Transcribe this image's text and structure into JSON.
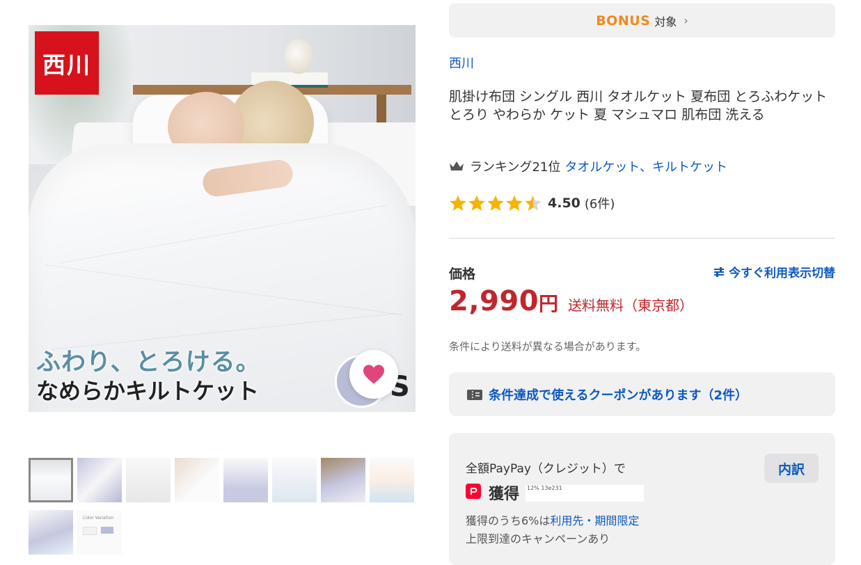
{
  "product_image": {
    "brand_badge": "西川",
    "catch_line1": "ふわり、とろける。",
    "catch_line2": "なめらかキルトケット",
    "swatch_letter": "S"
  },
  "thumbnails": [
    {
      "name": "thumb-1",
      "selected": true
    },
    {
      "name": "thumb-2"
    },
    {
      "name": "thumb-3"
    },
    {
      "name": "thumb-4"
    },
    {
      "name": "thumb-5"
    },
    {
      "name": "thumb-6"
    },
    {
      "name": "thumb-7"
    },
    {
      "name": "thumb-8"
    },
    {
      "name": "thumb-9"
    },
    {
      "name": "thumb-10",
      "label": "Color Variation"
    }
  ],
  "bonus": {
    "logo": "BONUS",
    "label": "対象"
  },
  "store": {
    "name": "西川"
  },
  "product": {
    "title": "肌掛け布団 シングル 西川 タオルケット 夏布団 とろふわケット とろり やわらか ケット 夏 マシュマロ 肌布団 洗える",
    "ranking_label": "ランキング21位",
    "ranking_categories": "タオルケット、キルトケット",
    "rating_score": "4.50",
    "rating_count": "(6件)",
    "rating_value": 4.5
  },
  "price": {
    "label": "価格",
    "switch_link": "今すぐ利用表示切替",
    "amount": "2,990",
    "currency": "円",
    "shipping": "送料無料（東京都）",
    "condition_note": "条件により送料が異なる場合があります。"
  },
  "coupon": {
    "text": "条件達成で使えるクーポンがあります（2件）"
  },
  "paypay": {
    "line1": "全額PayPay（クレジット）で",
    "breakdown_button": "内訳",
    "earn_label": "獲得",
    "tiny_text": "12%  13e231",
    "line3_prefix": "獲得のうち6%は",
    "line3_link": "利用先・期間限定",
    "line4": "上限到達のキャンペーンあり"
  },
  "colors": {
    "brand_red": "#d7121c",
    "link_blue": "#0d59c2",
    "price_red": "#c0262c",
    "star_gold": "#f5b400",
    "bonus_orange": "#f08a1c",
    "paypay_red": "#ff0033",
    "favorite_pink": "#e0457b"
  },
  "icons": {
    "bonus": "bonus-logo-icon",
    "chevron": "chevron-right-icon",
    "crown": "crown-icon",
    "star": "star-icon",
    "switch": "sliders-icon",
    "coupon": "coupon-icon",
    "favorite": "heart-icon",
    "paypay": "paypay-icon"
  }
}
